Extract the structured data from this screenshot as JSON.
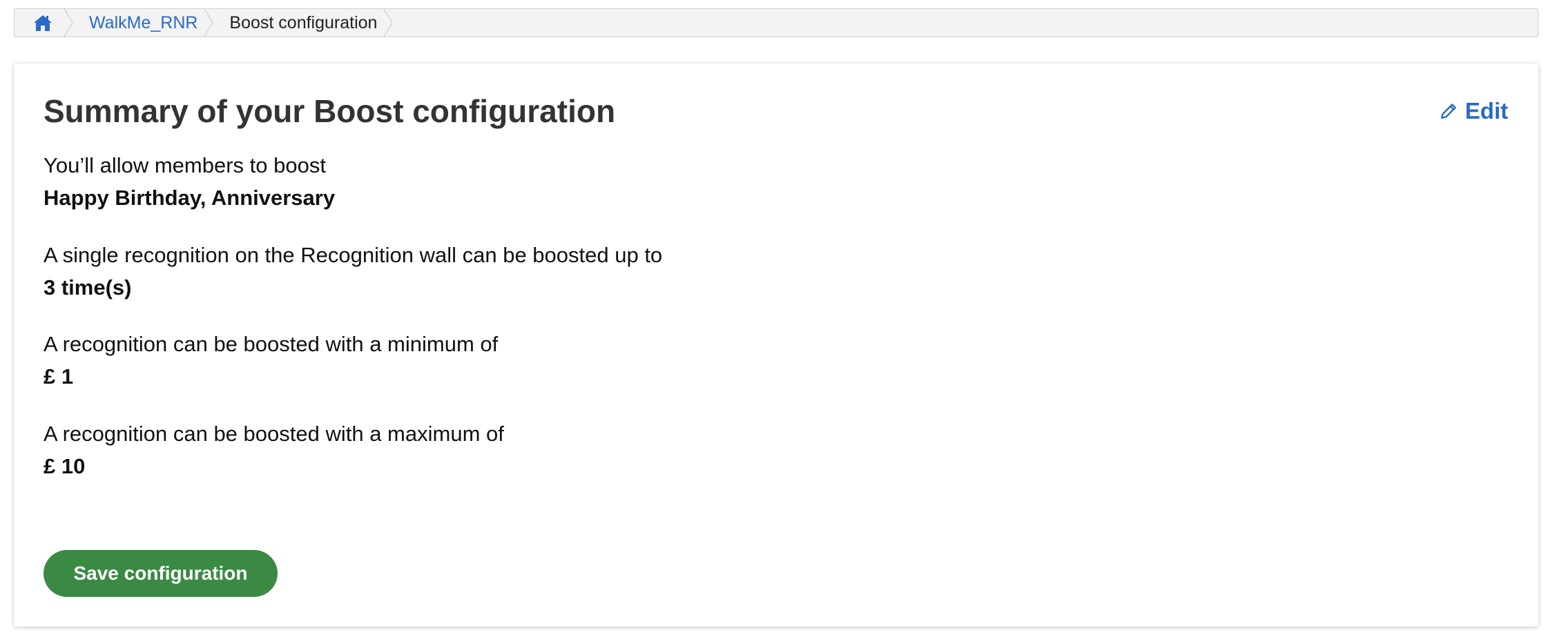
{
  "breadcrumb": {
    "home_icon": "home-icon",
    "items": [
      {
        "label": "WalkMe_RNR",
        "link": true
      },
      {
        "label": "Boost configuration",
        "link": false
      }
    ]
  },
  "summary": {
    "title": "Summary of your Boost configuration",
    "edit_label": "Edit",
    "edit_icon": "pencil-icon",
    "sections": [
      {
        "label": "You’ll allow members to boost",
        "value": "Happy Birthday, Anniversary"
      },
      {
        "label": "A single recognition on the Recognition wall can be boosted up to",
        "value": "3 time(s)"
      },
      {
        "label": "A recognition can be boosted with a minimum of",
        "value": "£ 1"
      },
      {
        "label": "A recognition can be boosted with a maximum of",
        "value": "£ 10"
      }
    ],
    "save_label": "Save configuration"
  },
  "colors": {
    "link": "#2a6ac6",
    "primary_button": "#3a8a44"
  }
}
